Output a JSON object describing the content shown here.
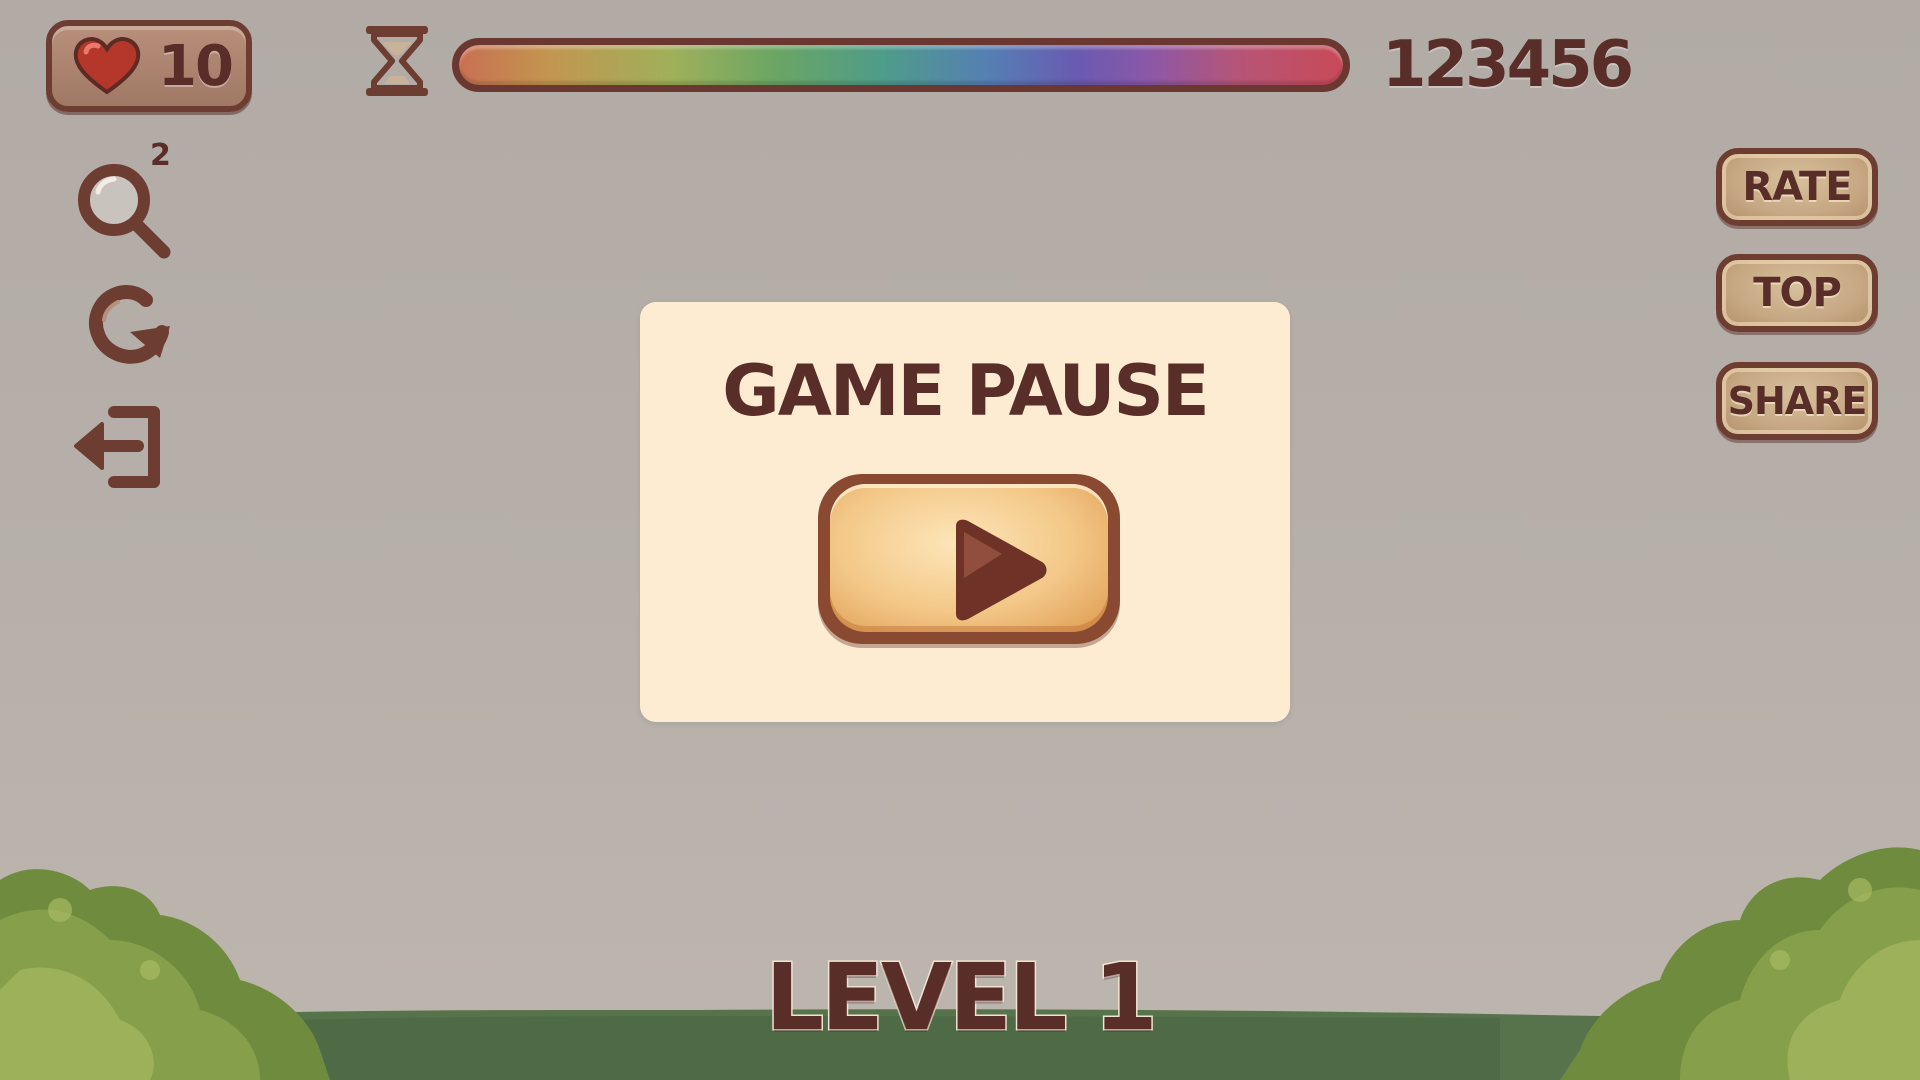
{
  "hud": {
    "lives": "10",
    "score": "123456",
    "timer_fraction": 1.0,
    "icons": {
      "lives": "heart-icon",
      "timer": "hourglass-icon"
    }
  },
  "tools": {
    "search": {
      "icon": "magnifier-icon",
      "count": "2"
    },
    "restart": {
      "icon": "restart-icon"
    },
    "exit": {
      "icon": "exit-icon"
    }
  },
  "side_buttons": {
    "rate": "RATE",
    "top": "TOP",
    "share": "SHARE"
  },
  "pause_dialog": {
    "title": "GAME PAUSE",
    "play_icon": "play-icon"
  },
  "level": "LEVEL 1",
  "colors": {
    "brown_dark": "#5a2e28",
    "panel_cream": "#feecd2",
    "play_gold": "#f3c787",
    "sky": "#b2aba5",
    "grass": "#56734c",
    "bush": "#7f9a48"
  }
}
